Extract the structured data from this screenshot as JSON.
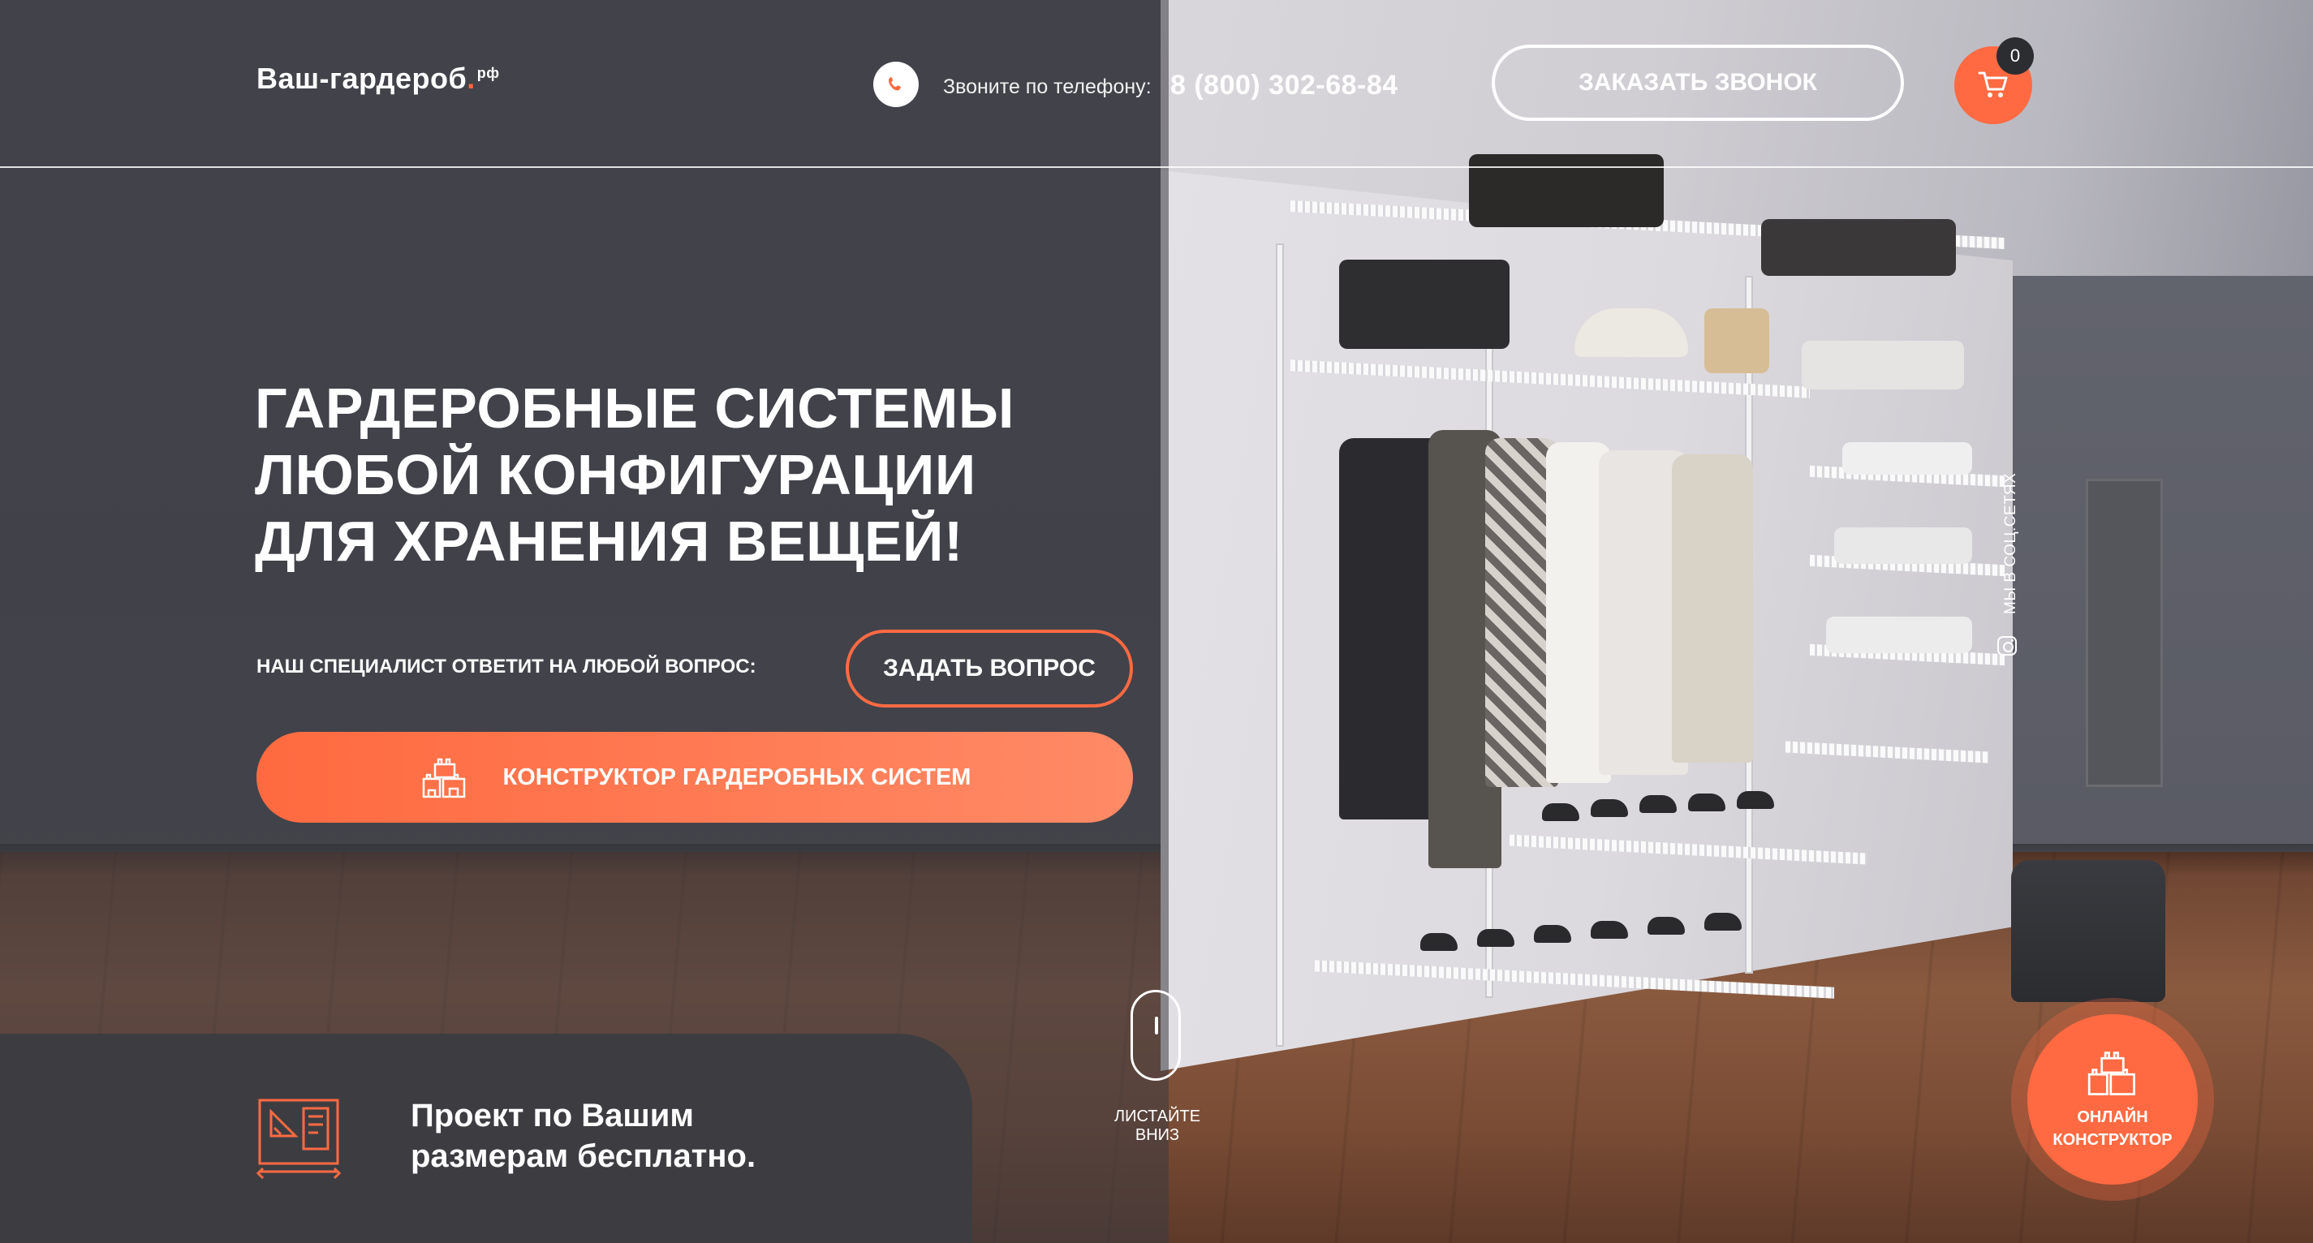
{
  "header": {
    "logo_main": "Ваш-гардероб",
    "logo_dot": ".",
    "logo_tld": "рф",
    "phone_label": "Звоните по телефону:",
    "phone_number": "8 (800) 302-68-84",
    "callback_label": "ЗАКАЗАТЬ ЗВОНОК",
    "cart_count": "0"
  },
  "hero": {
    "title_lines": [
      "ГАРДЕРОБНЫЕ СИСТЕМЫ",
      "ЛЮБОЙ КОНФИГУРАЦИИ",
      "ДЛЯ ХРАНЕНИЯ ВЕЩЕЙ!"
    ],
    "ask_label": "НАШ СПЕЦИАЛИСТ ОТВЕТИТ НА ЛЮБОЙ ВОПРОС:",
    "ask_button": "ЗАДАТЬ ВОПРОС",
    "builder_button": "КОНСТРУКТОР ГАРДЕРОБНЫХ СИСТЕМ"
  },
  "scroll": {
    "label": "ЛИСТАЙТЕ ВНИЗ"
  },
  "social": {
    "label": "МЫ В СОЦ.СЕТЯХ",
    "icon": "instagram-icon"
  },
  "promo": {
    "lines": [
      "Проект по Вашим",
      "размерам бесплатно."
    ],
    "icon": "blueprint-icon"
  },
  "floating": {
    "lines": [
      "ОНЛАЙН",
      "КОНСТРУКТОР"
    ],
    "icon": "blocks-icon"
  },
  "colors": {
    "accent": "#ff6a42",
    "dark_panel": "#3d3d41",
    "wall": "#4a4b52"
  }
}
